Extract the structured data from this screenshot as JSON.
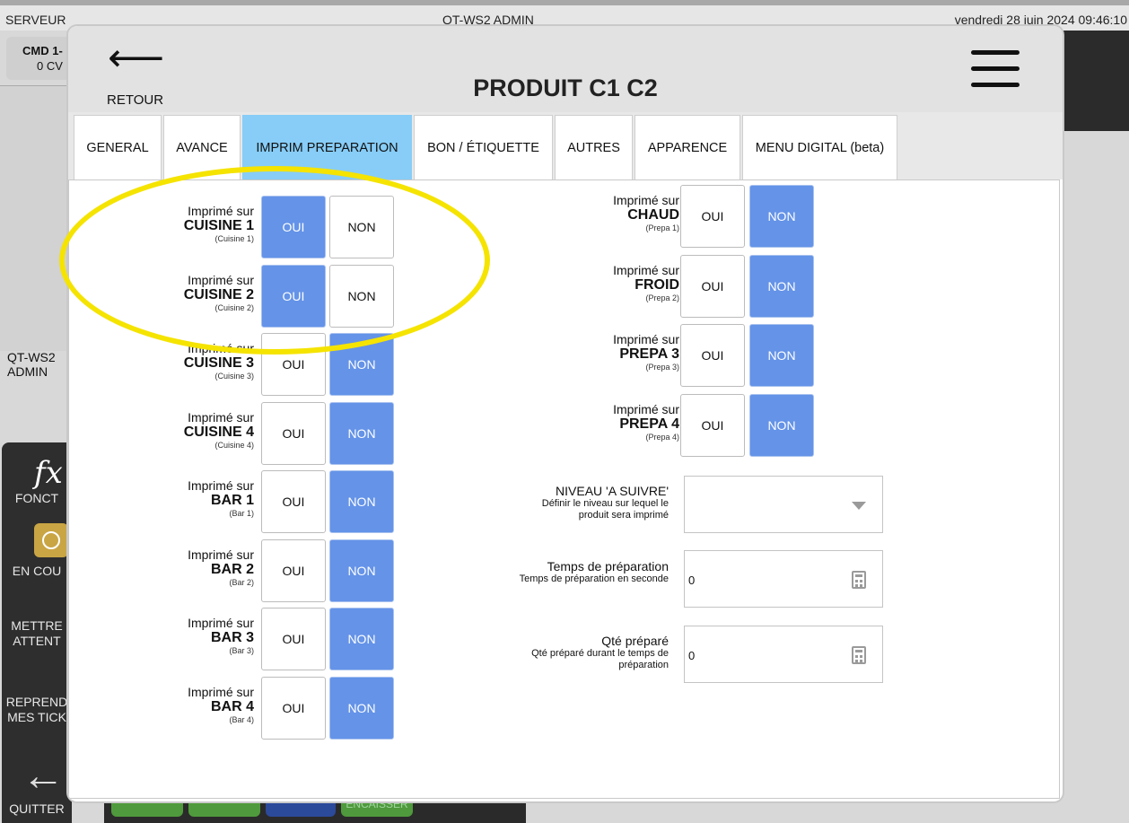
{
  "topbar": {
    "left": "SERVEUR",
    "center": "QT-WS2  ADMIN",
    "right": "vendredi 28 juin 2024   09:46:10"
  },
  "cmd_tile": {
    "title": "CMD 1-",
    "covers": "0 CV"
  },
  "bg_user": {
    "line1": "QT-WS2",
    "line2": "ADMIN"
  },
  "leftnav": {
    "fonctions": "FONCT",
    "en_cours": "EN COU",
    "mettre_attente_1": "METTRE",
    "mettre_attente_2": "ATTENT",
    "reprendre_1": "REPREND",
    "reprendre_2": "MES TICK",
    "quitter": "QUITTER",
    "encaisser": "ENCAISSER"
  },
  "modal": {
    "back_label": "RETOUR",
    "title": "PRODUIT C1 C2",
    "tabs": [
      "GENERAL",
      "AVANCE",
      "IMPRIM PREPARATION",
      "BON / ÉTIQUETTE",
      "AUTRES",
      "APPARENCE",
      "MENU DIGITAL (beta)"
    ],
    "active_tab": "IMPRIM PREPARATION",
    "printed_on": "Imprimé sur",
    "oui": "OUI",
    "non": "NON",
    "left_printers": [
      {
        "name": "CUISINE 1",
        "sub": "(Cuisine 1)",
        "value": "OUI"
      },
      {
        "name": "CUISINE 2",
        "sub": "(Cuisine 2)",
        "value": "OUI"
      },
      {
        "name": "CUISINE 3",
        "sub": "(Cuisine 3)",
        "value": "NON"
      },
      {
        "name": "CUISINE 4",
        "sub": "(Cuisine 4)",
        "value": "NON"
      },
      {
        "name": "BAR 1",
        "sub": "(Bar 1)",
        "value": "NON"
      },
      {
        "name": "BAR 2",
        "sub": "(Bar 2)",
        "value": "NON"
      },
      {
        "name": "BAR 3",
        "sub": "(Bar 3)",
        "value": "NON"
      },
      {
        "name": "BAR 4",
        "sub": "(Bar 4)",
        "value": "NON"
      }
    ],
    "right_printers": [
      {
        "name": "CHAUD",
        "sub": "(Prepa 1)",
        "value": "NON"
      },
      {
        "name": "FROID",
        "sub": "(Prepa 2)",
        "value": "NON"
      },
      {
        "name": "PREPA 3",
        "sub": "(Prepa 3)",
        "value": "NON"
      },
      {
        "name": "PREPA 4",
        "sub": "(Prepa 4)",
        "value": "NON"
      }
    ],
    "niveau": {
      "title": "NIVEAU 'A SUIVRE'",
      "sub1": "Définir le niveau sur lequel le",
      "sub2": "produit sera imprimé",
      "value": ""
    },
    "temps": {
      "title": "Temps de préparation",
      "sub": "Temps de préparation en seconde",
      "value": "0"
    },
    "qte": {
      "title": "Qté préparé",
      "sub1": "Qté préparé durant le temps de",
      "sub2": "préparation",
      "value": "0"
    }
  },
  "colors": {
    "selected": "#6493e8",
    "active_tab": "#87cdf7",
    "highlight": "#f5e300"
  }
}
